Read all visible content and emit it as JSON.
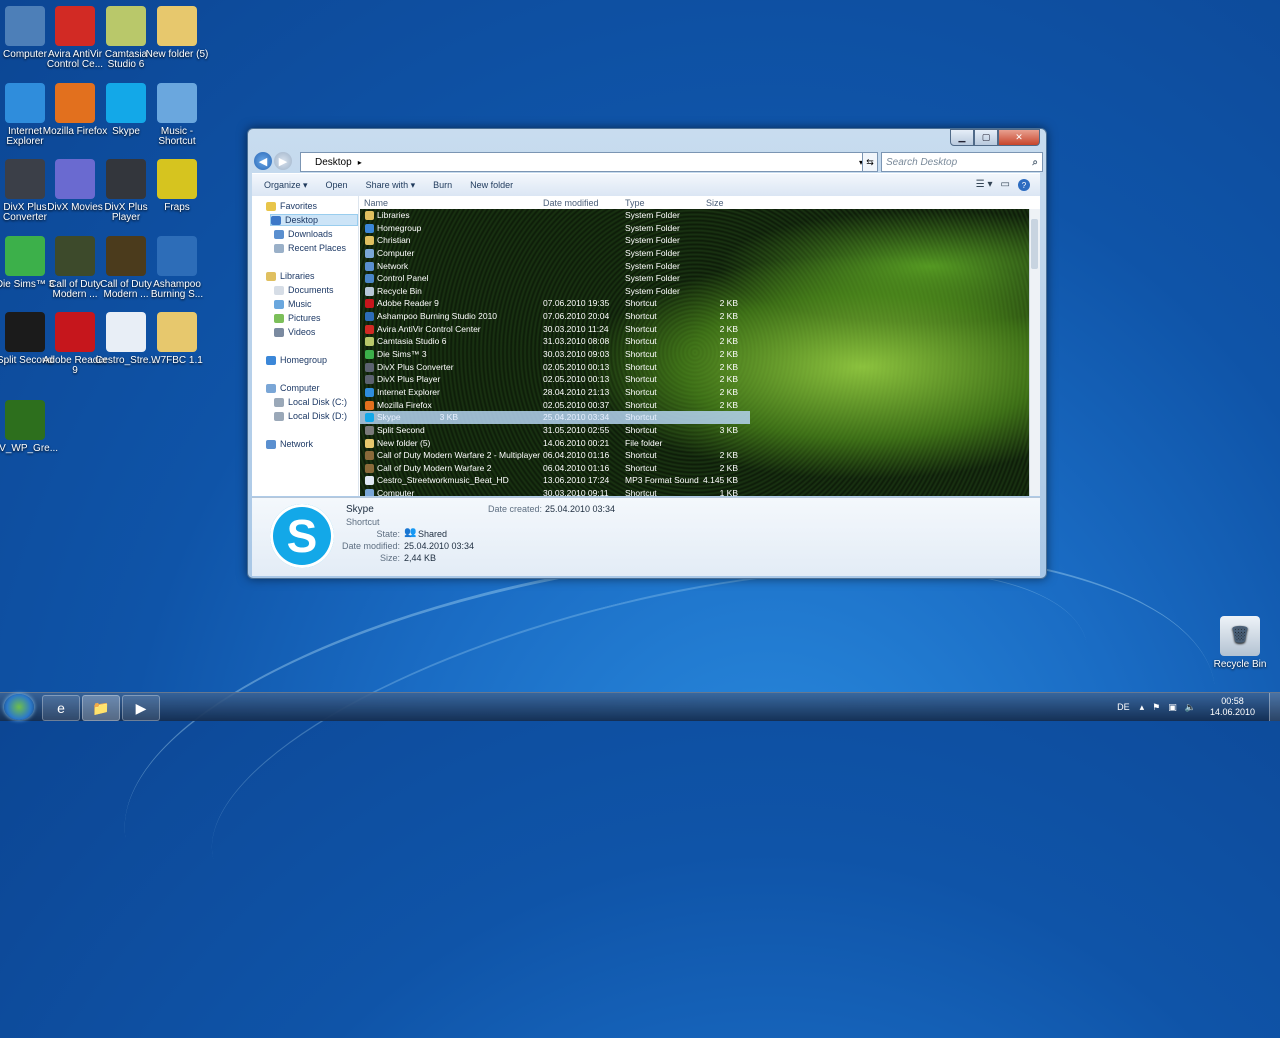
{
  "desktop_icons": [
    {
      "label": "Computer",
      "icon": "computer-icon",
      "color": "#4d7fb8"
    },
    {
      "label": "Avira AntiVir Control Ce...",
      "icon": "avira-icon",
      "color": "#d22a24"
    },
    {
      "label": "Camtasia Studio 6",
      "icon": "camtasia-icon",
      "color": "#b9c86a"
    },
    {
      "label": "New folder (5)",
      "icon": "folder-icon",
      "color": "#e7c86d"
    },
    {
      "label": "Internet Explorer",
      "icon": "ie-icon",
      "color": "#2f8ddc"
    },
    {
      "label": "Mozilla Firefox",
      "icon": "firefox-icon",
      "color": "#e2701e"
    },
    {
      "label": "Skype",
      "icon": "skype-icon",
      "color": "#13a8e8"
    },
    {
      "label": "Music - Shortcut",
      "icon": "music-icon",
      "color": "#6aa7de"
    },
    {
      "label": "DivX Plus Converter",
      "icon": "divx-converter-icon",
      "color": "#3b3f48"
    },
    {
      "label": "DivX Movies",
      "icon": "divx-movies-icon",
      "color": "#6a6ad0"
    },
    {
      "label": "DivX Plus Player",
      "icon": "divx-player-icon",
      "color": "#33363c"
    },
    {
      "label": "Fraps",
      "icon": "fraps-icon",
      "color": "#d6c41f"
    },
    {
      "label": "Die Sims™ 3",
      "icon": "sims-icon",
      "color": "#3cb04a"
    },
    {
      "label": "Call of Duty Modern ...",
      "icon": "cod-icon",
      "color": "#3d4a2b"
    },
    {
      "label": "Call of Duty Modern ...",
      "icon": "cod2-icon",
      "color": "#4b3b1c"
    },
    {
      "label": "Ashampoo Burning S...",
      "icon": "ashampoo-icon",
      "color": "#2d6db8"
    },
    {
      "label": "Split Second",
      "icon": "splitsecond-icon",
      "color": "#1b1b1b"
    },
    {
      "label": "Adobe Reader 9",
      "icon": "adobe-icon",
      "color": "#c6161c"
    },
    {
      "label": "Cestro_Stre...",
      "icon": "mp3-icon",
      "color": "#e8eef6"
    },
    {
      "label": "W7FBC 1.1",
      "icon": "folder-icon",
      "color": "#e7c86d"
    },
    {
      "label": "NV_WP_Gre...",
      "icon": "nvidia-icon",
      "color": "#2d6f1d"
    }
  ],
  "recycle_bin": {
    "label": "Recycle Bin"
  },
  "window": {
    "breadcrumb": "Desktop",
    "search_placeholder": "Search Desktop",
    "toolbar": {
      "organize": "Organize ▾",
      "open": "Open",
      "share": "Share with ▾",
      "burn": "Burn",
      "new_folder": "New folder"
    },
    "nav": {
      "favorites": "Favorites",
      "desktop": "Desktop",
      "downloads": "Downloads",
      "recent": "Recent Places",
      "libraries": "Libraries",
      "documents": "Documents",
      "music": "Music",
      "pictures": "Pictures",
      "videos": "Videos",
      "homegroup": "Homegroup",
      "computer": "Computer",
      "disk_c": "Local Disk (C:)",
      "disk_d": "Local Disk (D:)",
      "network": "Network"
    },
    "columns": {
      "name": "Name",
      "date": "Date modified",
      "type": "Type",
      "size": "Size"
    },
    "rows": [
      {
        "name": "Libraries",
        "date": "",
        "type": "System Folder",
        "size": "",
        "color": "#e0c060"
      },
      {
        "name": "Homegroup",
        "date": "",
        "type": "System Folder",
        "size": "",
        "color": "#3b87d8"
      },
      {
        "name": "Christian",
        "date": "",
        "type": "System Folder",
        "size": "",
        "color": "#e0c060"
      },
      {
        "name": "Computer",
        "date": "",
        "type": "System Folder",
        "size": "",
        "color": "#7aa6d6"
      },
      {
        "name": "Network",
        "date": "",
        "type": "System Folder",
        "size": "",
        "color": "#5a8fcf"
      },
      {
        "name": "Control Panel",
        "date": "",
        "type": "System Folder",
        "size": "",
        "color": "#4a86c8"
      },
      {
        "name": "Recycle Bin",
        "date": "",
        "type": "System Folder",
        "size": "",
        "color": "#b8c8d8"
      },
      {
        "name": "Adobe Reader 9",
        "date": "07.06.2010 19:35",
        "type": "Shortcut",
        "size": "2 KB",
        "color": "#c6161c"
      },
      {
        "name": "Ashampoo Burning Studio 2010",
        "date": "07.06.2010 20:04",
        "type": "Shortcut",
        "size": "2 KB",
        "color": "#2d6db8"
      },
      {
        "name": "Avira AntiVir Control Center",
        "date": "30.03.2010 11:24",
        "type": "Shortcut",
        "size": "2 KB",
        "color": "#d22a24"
      },
      {
        "name": "Camtasia Studio 6",
        "date": "31.03.2010 08:08",
        "type": "Shortcut",
        "size": "2 KB",
        "color": "#b9c86a"
      },
      {
        "name": "Die Sims™ 3",
        "date": "30.03.2010 09:03",
        "type": "Shortcut",
        "size": "2 KB",
        "color": "#3cb04a"
      },
      {
        "name": "DivX Plus Converter",
        "date": "02.05.2010 00:13",
        "type": "Shortcut",
        "size": "2 KB",
        "color": "#5c6270"
      },
      {
        "name": "DivX Plus Player",
        "date": "02.05.2010 00:13",
        "type": "Shortcut",
        "size": "2 KB",
        "color": "#5c6270"
      },
      {
        "name": "Internet Explorer",
        "date": "28.04.2010 21:13",
        "type": "Shortcut",
        "size": "2 KB",
        "color": "#2f8ddc"
      },
      {
        "name": "Mozilla Firefox",
        "date": "02.05.2010 00:37",
        "type": "Shortcut",
        "size": "2 KB",
        "color": "#e2701e"
      },
      {
        "name": "Skype",
        "date": "25.04.2010 03:34",
        "type": "Shortcut",
        "size": "3 KB",
        "color": "#13a8e8",
        "selected": true
      },
      {
        "name": "Split Second",
        "date": "31.05.2010 02:55",
        "type": "Shortcut",
        "size": "3 KB",
        "color": "#7a7a7a"
      },
      {
        "name": "New folder (5)",
        "date": "14.06.2010 00:21",
        "type": "File folder",
        "size": "",
        "color": "#e7c86d"
      },
      {
        "name": "Call of Duty Modern Warfare 2 - Multiplayer",
        "date": "06.04.2010 01:16",
        "type": "Shortcut",
        "size": "2 KB",
        "color": "#8a6a3a"
      },
      {
        "name": "Call of Duty Modern Warfare 2",
        "date": "06.04.2010 01:16",
        "type": "Shortcut",
        "size": "2 KB",
        "color": "#8a6a3a"
      },
      {
        "name": "Cestro_Streetworkmusic_Beat_HD",
        "date": "13.06.2010 17:24",
        "type": "MP3 Format Sound",
        "size": "4.145 KB",
        "color": "#dfe8f3"
      },
      {
        "name": "Computer",
        "date": "30.03.2010 09:11",
        "type": "Shortcut",
        "size": "1 KB",
        "color": "#7aa6d6"
      }
    ],
    "details": {
      "name": "Skype",
      "kind": "Shortcut",
      "state_label": "State:",
      "state_value": "Shared",
      "modified_label": "Date modified:",
      "modified_value": "25.04.2010 03:34",
      "size_label": "Size:",
      "size_value": "2,44 KB",
      "created_label": "Date created:",
      "created_value": "25.04.2010 03:34"
    }
  },
  "taskbar": {
    "lang": "DE",
    "time": "00:58",
    "date": "14.06.2010"
  }
}
